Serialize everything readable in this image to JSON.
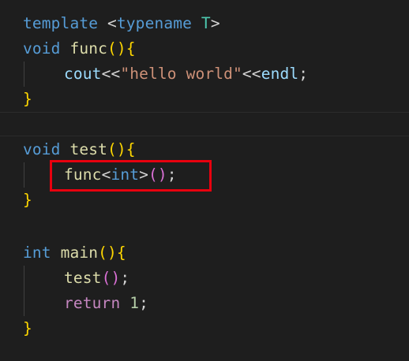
{
  "code": {
    "l1": {
      "kw": "template",
      "sp": " ",
      "lt": "<",
      "kw2": "typename",
      "sp2": " ",
      "t": "T",
      "gt": ">"
    },
    "l2": {
      "kw": "void",
      "sp": " ",
      "fn": "func",
      "paren": "()",
      "brace": "{"
    },
    "l3": {
      "var": "cout",
      "op": "<<",
      "str": "\"hello world\"",
      "op2": "<<",
      "var2": "endl",
      "semi": ";"
    },
    "l4": {
      "brace": "}"
    },
    "l6": {
      "kw": "void",
      "sp": " ",
      "fn": "test",
      "paren": "()",
      "brace": "{"
    },
    "l7": {
      "fn": "func",
      "lt": "<",
      "kw": "int",
      "gt": ">",
      "paren": "()",
      "semi": ";"
    },
    "l8": {
      "brace": "}"
    },
    "l10": {
      "kw": "int",
      "sp": " ",
      "fn": "main",
      "paren": "()",
      "brace": "{"
    },
    "l11": {
      "fn": "test",
      "paren": "()",
      "semi": ";"
    },
    "l12": {
      "kw": "return",
      "sp": " ",
      "num": "1",
      "semi": ";"
    },
    "l13": {
      "brace": "}"
    }
  },
  "colors": {
    "background": "#1e1e1e",
    "keyword": "#569cd6",
    "control_keyword": "#c586c0",
    "function": "#dcdcaa",
    "variable": "#9cdcfe",
    "string": "#ce9178",
    "number": "#b5cea8",
    "type_param": "#4ec9b0",
    "bracket_level1": "#ffd700",
    "bracket_level2": "#da70d6",
    "highlight_box": "#e8000e"
  }
}
